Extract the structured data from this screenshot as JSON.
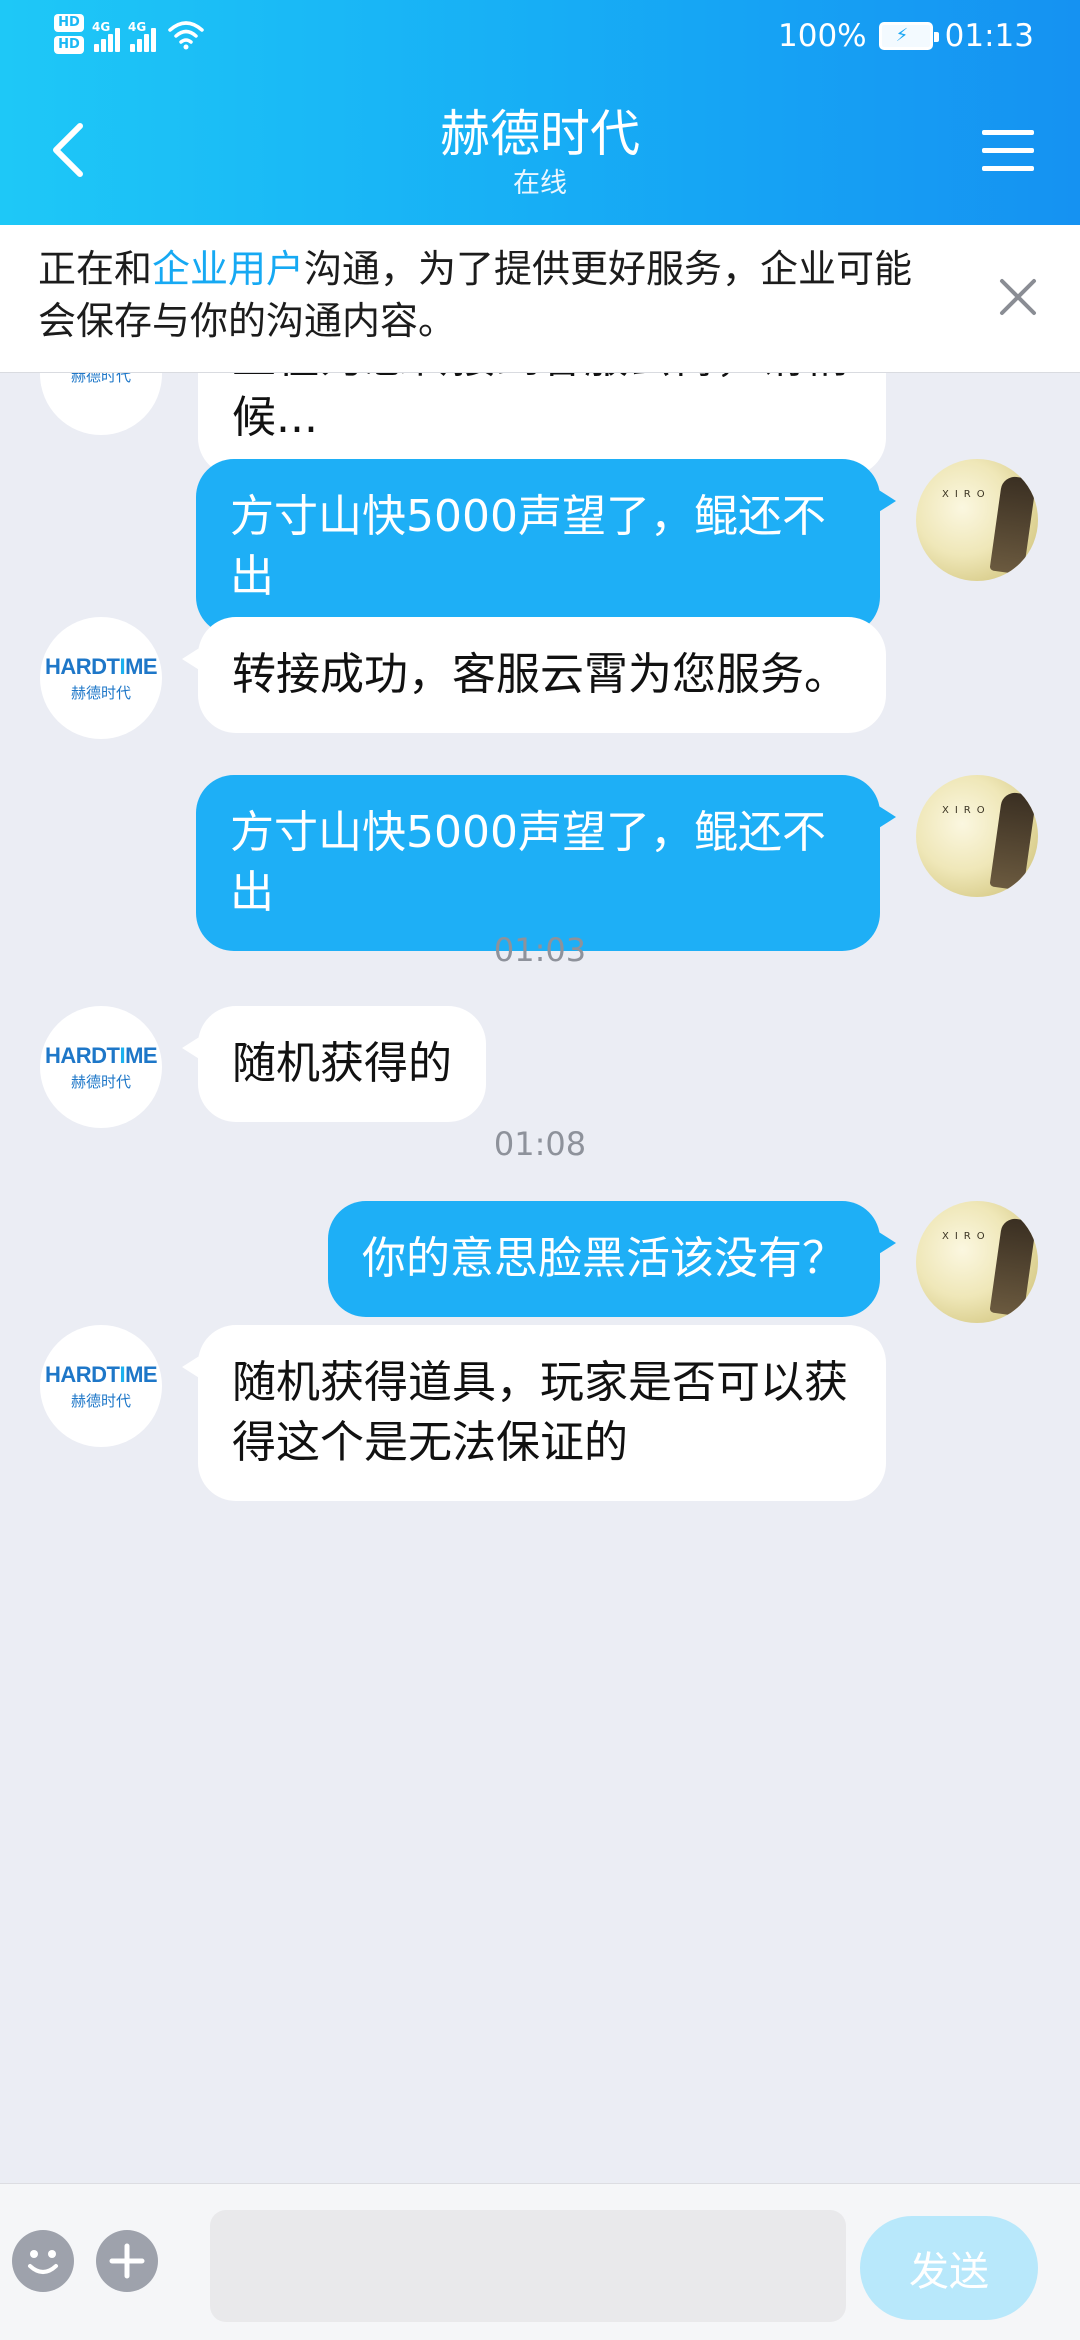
{
  "status_bar": {
    "left_icons": [
      "hd-badge-icon",
      "hd-badge-icon",
      "4g-signal-icon",
      "4g-signal-icon",
      "wifi-icon"
    ],
    "hd_label": "HD",
    "network_label": "4G",
    "battery_percent": "100%",
    "time": "01:13"
  },
  "header": {
    "title": "赫德时代",
    "subtitle": "在线",
    "back_icon": "chevron-left-icon",
    "menu_icon": "hamburger-menu-icon"
  },
  "notice": {
    "prefix": "正在和",
    "highlight": "企业用户",
    "suffix": "沟通，为了提供更好服务，企业可能会保存与你的沟通内容。",
    "close_icon": "close-icon"
  },
  "colors": {
    "header_start": "#1ec8f7",
    "header_end": "#1592f2",
    "outgoing_bubble": "#1eaff6",
    "incoming_bubble": "#ffffff",
    "chat_background": "#ebedf4",
    "highlight_text": "#16a9f3"
  },
  "biz_avatar": {
    "logo_prefix": "HARDT",
    "logo_o": "I",
    "logo_suffix": "ME",
    "logo_sub": "赫德时代"
  },
  "user_avatar": {
    "logo_text": "XIRO"
  },
  "messages": [
    {
      "type": "in",
      "text": "正在为您转接到客服云霄，请稍候..."
    },
    {
      "type": "out",
      "text": "方寸山快5000声望了，鲲还不出"
    },
    {
      "type": "in",
      "text": "转接成功，客服云霄为您服务。"
    },
    {
      "type": "out",
      "text": "方寸山快5000声望了，鲲还不出"
    },
    {
      "type": "time",
      "text": "01:03"
    },
    {
      "type": "in",
      "text": "随机获得的"
    },
    {
      "type": "time",
      "text": "01:08"
    },
    {
      "type": "out",
      "text": "你的意思脸黑活该没有？"
    },
    {
      "type": "in",
      "text": "随机获得道具，玩家是否可以获得这个是无法保证的"
    }
  ],
  "composer": {
    "emoji_icon": "emoji-smile-icon",
    "plus_icon": "plus-icon",
    "input_value": "",
    "send_label": "发送"
  }
}
